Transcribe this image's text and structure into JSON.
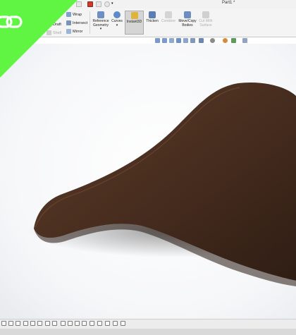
{
  "window": {
    "title": "Part1 *"
  },
  "ribbon": {
    "wrap": "Wrap",
    "intersect": "Intersect",
    "mirror": "Mirror",
    "draft": "Draft",
    "shell": "Shell",
    "reference_geometry": "Reference Geometry",
    "curves": "Curves",
    "instant3d": "Instant3D",
    "thicken": "Thicken",
    "combine": "Combine",
    "move_copy_bodies": "Move/Copy Bodies",
    "cut_with_surface": "Cut With Surface"
  },
  "colors": {
    "promo_green": "#5ff542",
    "saddle_dark": "#3d2519",
    "saddle_mid": "#5a3826",
    "instant3d_active": "#d5d5d5"
  },
  "icons": {
    "promo_logo": "link-chain-logo-icon"
  }
}
